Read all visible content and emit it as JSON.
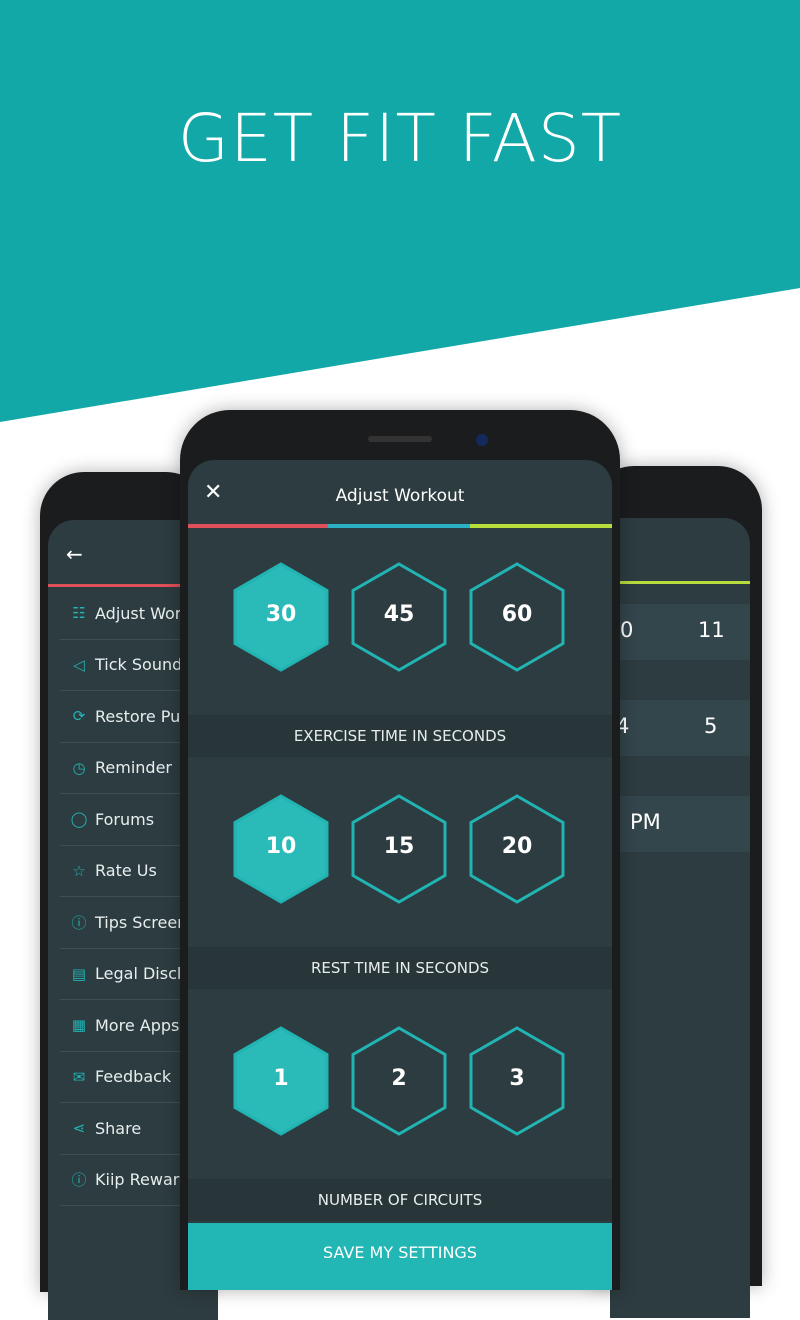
{
  "headline": "GET FIT FAST",
  "colors": {
    "teal": "#12a8a7",
    "screen": "#2d3c40",
    "accent": "#22b3b3",
    "red": "#e0505a",
    "blue": "#2bb0c4",
    "lime": "#b7dd3c"
  },
  "left_phone": {
    "back_icon": "arrow-left-icon",
    "menu": [
      {
        "label": "Adjust Wor",
        "icon": "sliders-icon"
      },
      {
        "label": "Tick Sound",
        "icon": "speaker-icon"
      },
      {
        "label": "Restore Pu",
        "icon": "refresh-icon"
      },
      {
        "label": "Reminder",
        "icon": "alarm-icon"
      },
      {
        "label": "Forums",
        "icon": "chat-icon"
      },
      {
        "label": "Rate Us",
        "icon": "star-icon"
      },
      {
        "label": "Tips Screen",
        "icon": "info-icon"
      },
      {
        "label": "Legal Discla",
        "icon": "book-icon"
      },
      {
        "label": "More Apps",
        "icon": "grid-icon"
      },
      {
        "label": "Feedback",
        "icon": "mail-icon"
      },
      {
        "label": "Share",
        "icon": "share-icon"
      },
      {
        "label": "Kiip Reward",
        "icon": "info-icon"
      }
    ]
  },
  "right_phone": {
    "rows": [
      [
        "0",
        "11"
      ],
      [
        "4",
        "5"
      ],
      [
        "PM",
        ""
      ]
    ]
  },
  "center_phone": {
    "title": "Adjust Workout",
    "close_icon": "close-icon",
    "sections": [
      {
        "options": [
          "30",
          "45",
          "60"
        ],
        "selected": "30",
        "label": "EXERCISE TIME IN SECONDS"
      },
      {
        "options": [
          "10",
          "15",
          "20"
        ],
        "selected": "10",
        "label": "REST TIME IN SECONDS"
      },
      {
        "options": [
          "1",
          "2",
          "3"
        ],
        "selected": "1",
        "label": "NUMBER OF CIRCUITS"
      }
    ],
    "save_label": "SAVE MY SETTINGS"
  }
}
